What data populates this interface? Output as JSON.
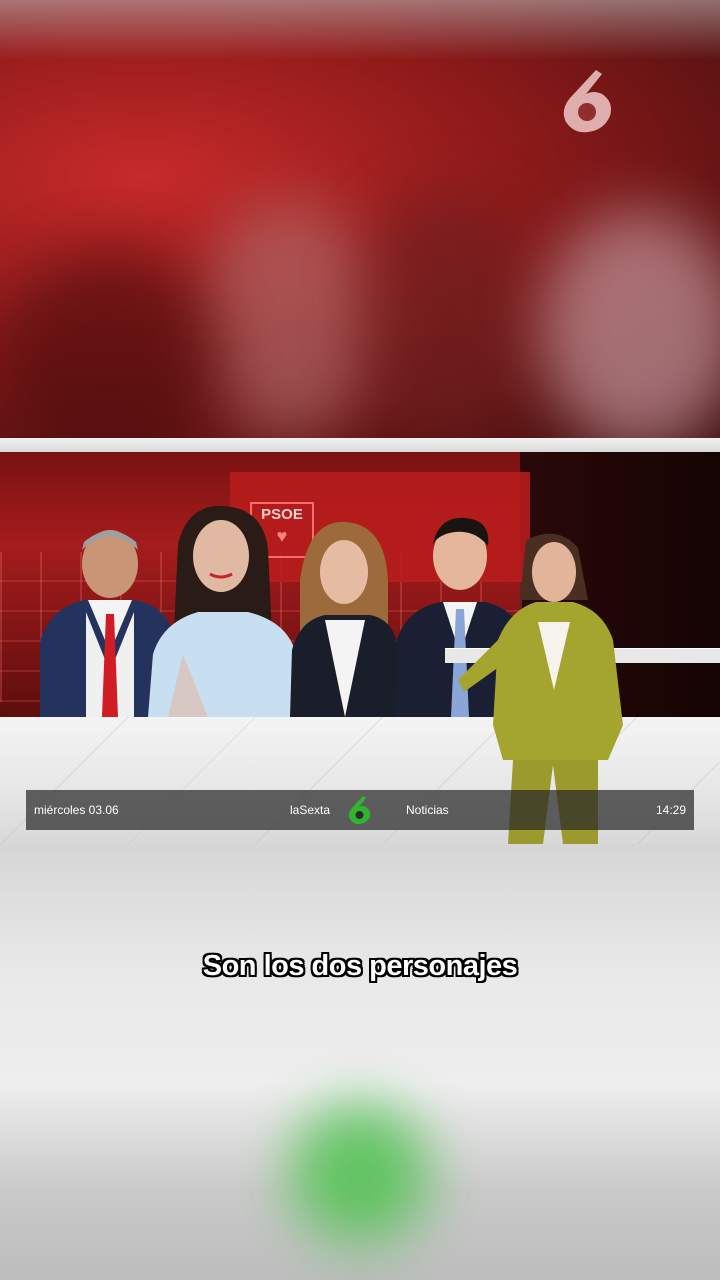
{
  "ticker": {
    "date": "miércoles 03.06",
    "brand": "laSexta",
    "section": "Noticias",
    "time": "14:29"
  },
  "screen": {
    "banner_text": "PSOE"
  },
  "subtitle": "Son los dos personajes",
  "colors": {
    "accent_green": "#2fb52f",
    "brand_red": "#b71c1c",
    "logo_pink": "#f0c8c8"
  },
  "icons": {
    "channel_logo": "lasexta-6-logo-icon",
    "ticker_logo": "lasexta-green-6-icon"
  }
}
